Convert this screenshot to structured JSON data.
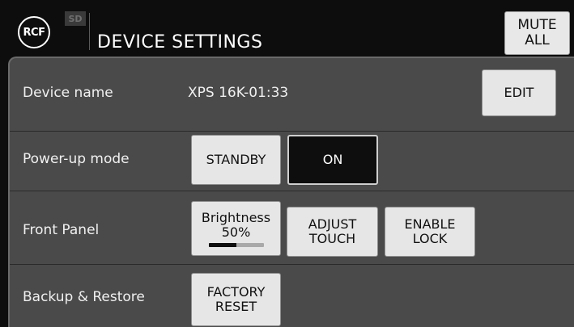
{
  "header": {
    "logo_text": "RCF",
    "sd_tag": "SD",
    "title": "DEVICE SETTINGS",
    "mute_button": [
      "MUTE",
      "ALL"
    ]
  },
  "rows": {
    "device_name": {
      "label": "Device name",
      "value": "XPS 16K-01:33",
      "edit_label": "EDIT"
    },
    "power_up": {
      "label": "Power-up mode",
      "standby_label": "STANDBY",
      "on_label": "ON",
      "selected": "ON"
    },
    "front_panel": {
      "label": "Front Panel",
      "brightness_label": "Brightness",
      "brightness_value": "50%",
      "brightness_fraction": 0.5,
      "adjust_touch": [
        "ADJUST",
        "TOUCH"
      ],
      "enable_lock": [
        "ENABLE",
        "LOCK"
      ]
    },
    "backup": {
      "label": "Backup & Restore",
      "factory_reset": [
        "FACTORY",
        "RESET"
      ]
    }
  },
  "colors": {
    "background": "#0d0d0d",
    "panel": "#4a4a4a",
    "button": "#e6e6e6",
    "selected_button": "#0e0e0e"
  }
}
